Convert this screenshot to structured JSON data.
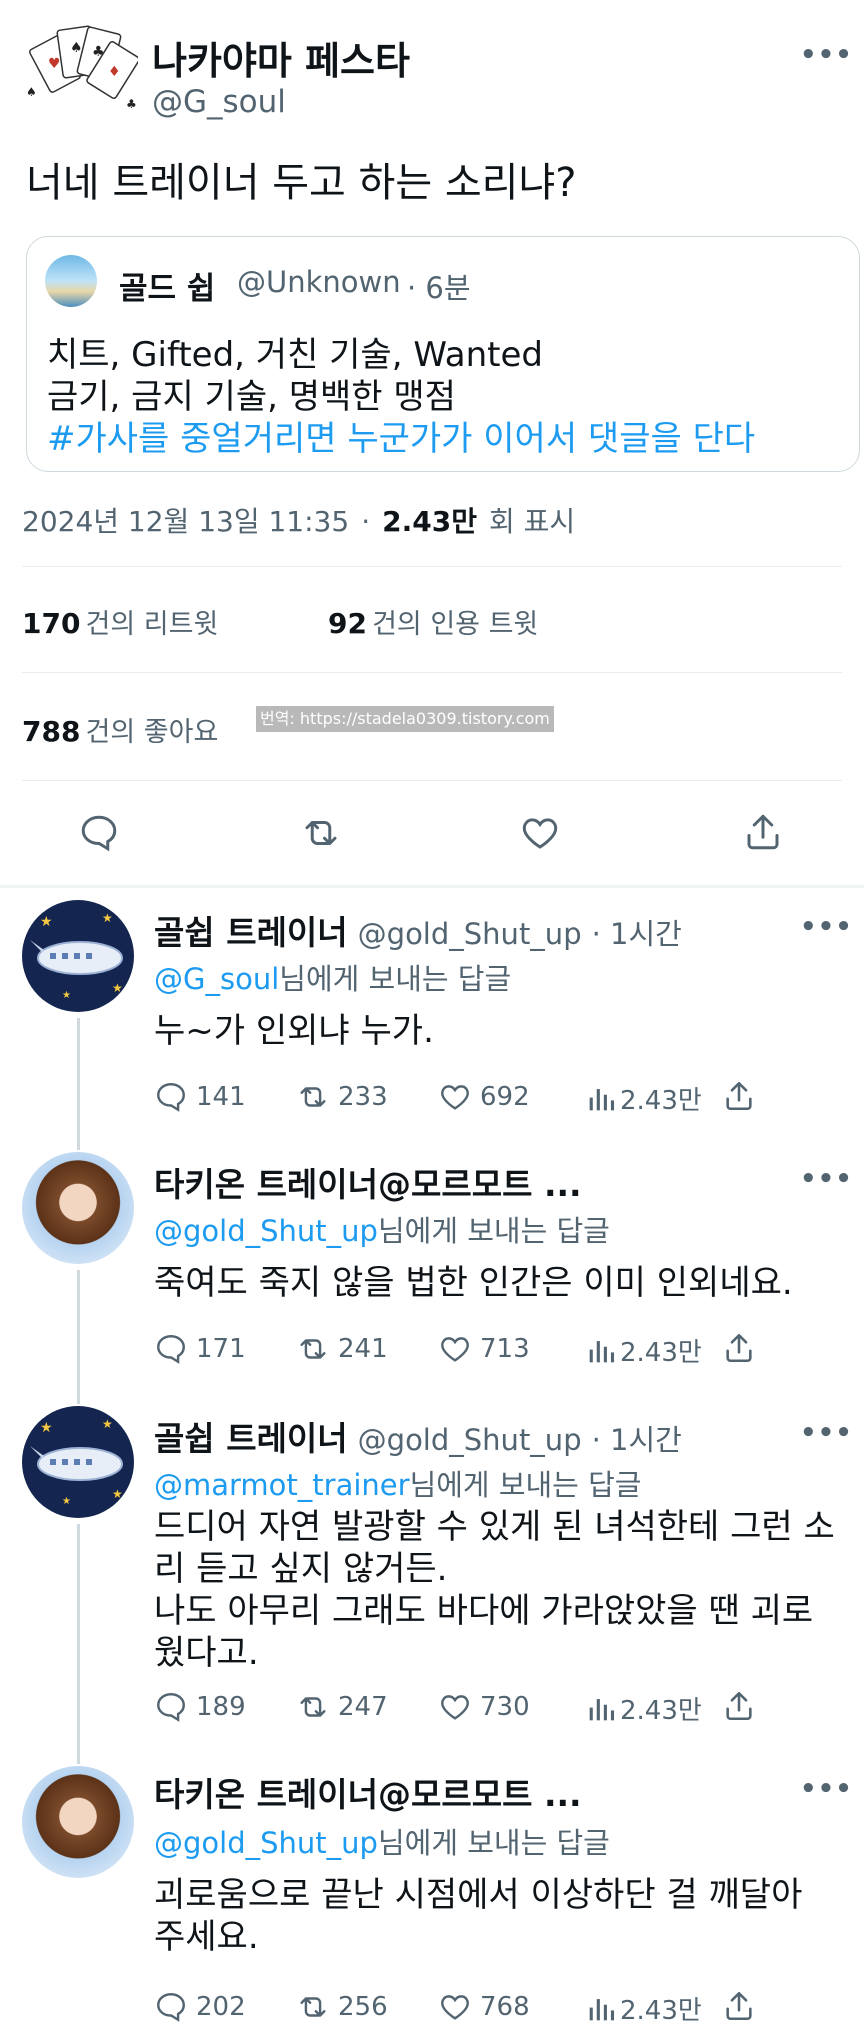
{
  "main_tweet": {
    "name": "나카야마 페스타",
    "handle": "@G_soul",
    "text": "너네 트레이너 두고 하는 소리냐?",
    "quote": {
      "name": "골드 쉽",
      "handle": "@Unknown",
      "time": "· 6분",
      "line1": "치트, Gifted, 거친 기술, Wanted",
      "line2": "금기, 금지 기술, 명백한 맹점",
      "hashtag": "#가사를 중얼거리면 누군가가 이어서 댓글을 단다"
    },
    "date": "2024년 12월 13일  11:35",
    "sep": "·",
    "views_num": "2.43만",
    "views_lbl": "회 표시",
    "retweets_num": "170",
    "retweets_lbl": "건의 리트윗",
    "quotes_num": "92",
    "quotes_lbl": "건의 인용 트윗",
    "likes_num": "788",
    "likes_lbl": "건의 좋아요",
    "watermark": "번역: https://stadela0309.tistory.com"
  },
  "more_label": "•••",
  "replies": [
    {
      "name": "골쉽 트레이너",
      "handle": "@gold_Shut_up",
      "time": "· 1시간",
      "reply_handle": "@G_soul",
      "reply_suffix": "님에게 보내는 답글",
      "text": "누~가 인외냐 누가.",
      "comments": "141",
      "retweets": "233",
      "likes": "692",
      "views": "2.43만"
    },
    {
      "name": "타키온 트레이너@모르모트 ...",
      "handle": "",
      "time": "",
      "reply_handle": "@gold_Shut_up",
      "reply_suffix": "님에게 보내는 답글",
      "text": "죽여도 죽지 않을 법한 인간은 이미 인외네요.",
      "comments": "171",
      "retweets": "241",
      "likes": "713",
      "views": "2.43만"
    },
    {
      "name": "골쉽 트레이너",
      "handle": "@gold_Shut_up",
      "time": "· 1시간",
      "reply_handle": "@marmot_trainer",
      "reply_suffix": "님에게 보내는 답글",
      "text": "드디어 자연 발광할 수 있게 된 녀석한테 그런 소리 듣고 싶지 않거든.\n나도 아무리 그래도 바다에 가라앉았을 땐 괴로웠다고.",
      "comments": "189",
      "retweets": "247",
      "likes": "730",
      "views": "2.43만"
    },
    {
      "name": "타키온 트레이너@모르모트 ...",
      "handle": "",
      "time": "",
      "reply_handle": "@gold_Shut_up",
      "reply_suffix": "님에게 보내는 답글",
      "text": "괴로움으로 끝난 시점에서 이상하단 걸 깨달아 주세요.",
      "comments": "202",
      "retweets": "256",
      "likes": "768",
      "views": "2.43만"
    }
  ],
  "colors": {
    "accent": "#1d9bf0",
    "text": "#0f1419",
    "muted": "#536471",
    "border": "#e6ecf0"
  }
}
